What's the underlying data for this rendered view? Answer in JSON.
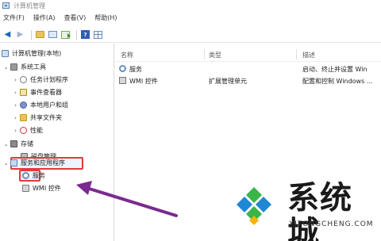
{
  "window": {
    "title": "计算机管理"
  },
  "menu": [
    "文件(F)",
    "操作(A)",
    "查看(V)",
    "帮助(H)"
  ],
  "toolbar": {
    "icons": [
      "back-icon",
      "forward-icon",
      "folder-icon",
      "console-tree-icon",
      "export-icon",
      "help-icon",
      "grid-icon"
    ]
  },
  "tree": {
    "root": "计算机管理(本地)",
    "system_tools": "系统工具",
    "task_scheduler": "任务计划程序",
    "event_viewer": "事件查看器",
    "local_users": "本地用户和组",
    "shared_folders": "共享文件夹",
    "performance": "性能",
    "storage": "存储",
    "disk_management": "磁盘管理",
    "services_apps": "服务和应用程序",
    "services": "服务",
    "wmi_control": "WMI 控件"
  },
  "list": {
    "columns": {
      "name": "名称",
      "type": "类型",
      "description": "描述"
    },
    "rows": [
      {
        "name": "服务",
        "type": "",
        "description": "启动、终止并设置 Win"
      },
      {
        "name": "WMI 控件",
        "type": "扩展管理单元",
        "description": "配置和控制 Windows ..."
      }
    ]
  },
  "watermark": {
    "brand": "系统城",
    "url": "XITONGCHENG.COM"
  },
  "colors": {
    "highlight_border": "#e23a3a",
    "arrow": "#7a2a8f",
    "accent": "#1b63b8"
  }
}
